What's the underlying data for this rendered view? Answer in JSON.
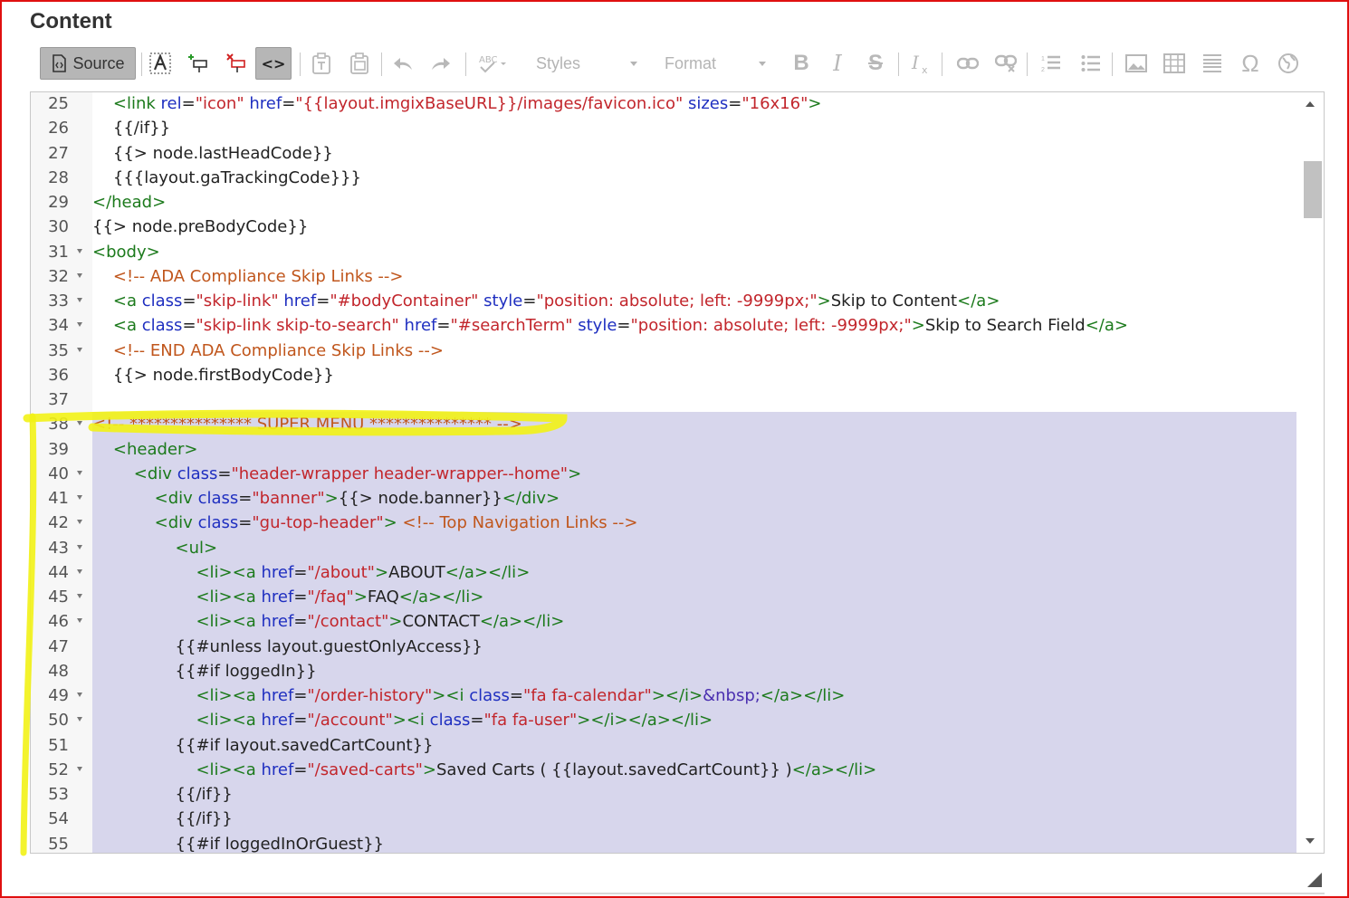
{
  "section_title": "Content",
  "toolbar": {
    "source_label": "Source",
    "styles_label": "Styles",
    "format_label": "Format",
    "icons": [
      "source-icon",
      "text-format-icon",
      "insert-field-icon",
      "remove-field-icon",
      "code-view-icon",
      "paste-text-icon",
      "paste-word-icon",
      "undo-icon",
      "redo-icon",
      "spellcheck-icon",
      "bold-icon",
      "italic-icon",
      "strikethrough-icon",
      "remove-format-icon",
      "link-icon",
      "unlink-icon",
      "numbered-list-icon",
      "bulleted-list-icon",
      "image-icon",
      "table-icon",
      "horizontal-rule-icon",
      "special-character-icon",
      "iframe-icon"
    ]
  },
  "editor": {
    "lines": [
      {
        "n": "25",
        "t": "    <link rel=\"icon\" href=\"{{layout.imgixBaseURL}}/images/favicon.ico\" sizes=\"16x16\">"
      },
      {
        "n": "26",
        "t": "    {{/if}}"
      },
      {
        "n": "27",
        "t": "    {{> node.lastHeadCode}}"
      },
      {
        "n": "28",
        "t": "    {{{layout.gaTrackingCode}}}"
      },
      {
        "n": "29",
        "t": "</head>"
      },
      {
        "n": "30",
        "t": "{{> node.preBodyCode}}"
      },
      {
        "n": "31",
        "t": "<body>"
      },
      {
        "n": "32",
        "t": "    <!-- ADA Compliance Skip Links -->"
      },
      {
        "n": "33",
        "t": "    <a class=\"skip-link\" href=\"#bodyContainer\" style=\"position: absolute; left: -9999px;\">Skip to Content</a>"
      },
      {
        "n": "34",
        "t": "    <a class=\"skip-link skip-to-search\" href=\"#searchTerm\" style=\"position: absolute; left: -9999px;\">Skip to Search Field</a>"
      },
      {
        "n": "35",
        "t": "    <!-- END ADA Compliance Skip Links -->"
      },
      {
        "n": "36",
        "t": "    {{> node.firstBodyCode}}"
      },
      {
        "n": "37",
        "t": ""
      },
      {
        "n": "38",
        "t": "<!-- *************** SUPER MENU *************** -->"
      },
      {
        "n": "39",
        "t": "    <header>"
      },
      {
        "n": "40",
        "t": "        <div class=\"header-wrapper header-wrapper--home\">"
      },
      {
        "n": "41",
        "t": "            <div class=\"banner\">{{> node.banner}}</div>"
      },
      {
        "n": "42",
        "t": "            <div class=\"gu-top-header\"> <!-- Top Navigation Links -->"
      },
      {
        "n": "43",
        "t": "                <ul>"
      },
      {
        "n": "44",
        "t": "                    <li><a href=\"/about\">ABOUT</a></li>"
      },
      {
        "n": "45",
        "t": "                    <li><a href=\"/faq\">FAQ</a></li>"
      },
      {
        "n": "46",
        "t": "                    <li><a href=\"/contact\">CONTACT</a></li>"
      },
      {
        "n": "47",
        "t": "                {{#unless layout.guestOnlyAccess}}"
      },
      {
        "n": "48",
        "t": "                {{#if loggedIn}}"
      },
      {
        "n": "49",
        "t": "                    <li><a href=\"/order-history\"><i class=\"fa fa-calendar\"></i>&nbsp;</a></li>"
      },
      {
        "n": "50",
        "t": "                    <li><a href=\"/account\"><i class=\"fa fa-user\"></i></a></li>"
      },
      {
        "n": "51",
        "t": "                {{#if layout.savedCartCount}}"
      },
      {
        "n": "52",
        "t": "                    <li><a href=\"/saved-carts\">Saved Carts ( {{layout.savedCartCount}} )</a></li>"
      },
      {
        "n": "53",
        "t": "                {{/if}}"
      },
      {
        "n": "54",
        "t": "                {{/if}}"
      },
      {
        "n": "55",
        "t": "                {{#if loggedInOrGuest}}"
      }
    ],
    "fold_lines": [
      "31",
      "32",
      "33",
      "34",
      "35",
      "38",
      "40",
      "41",
      "42",
      "43",
      "44",
      "45",
      "46",
      "49",
      "50",
      "52"
    ]
  }
}
